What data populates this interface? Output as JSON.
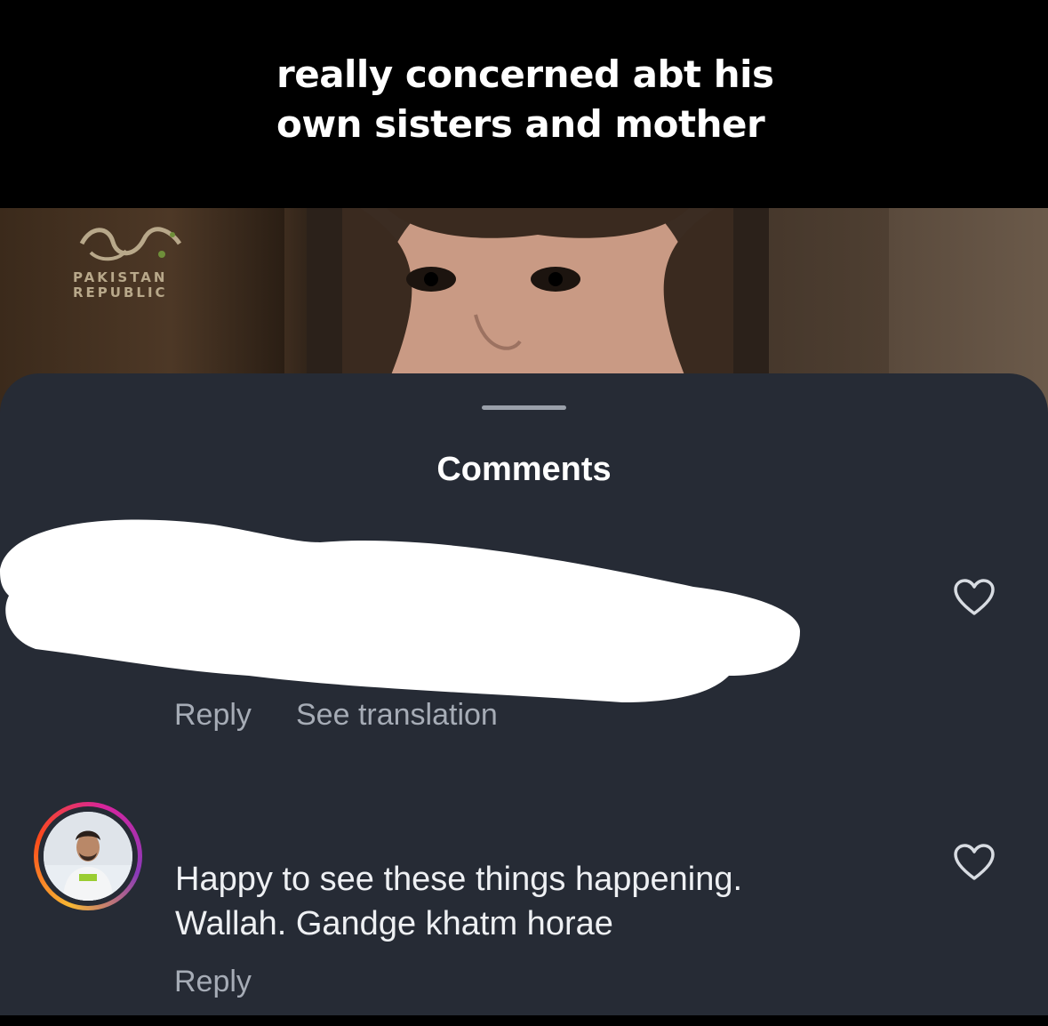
{
  "caption": {
    "line1": "really concerned abt his",
    "line2": "own sisters and mother"
  },
  "photo": {
    "logo_line1": "PAKISTAN",
    "logo_line2": "REPUBLIC"
  },
  "sheet": {
    "title": "Comments"
  },
  "comments": [
    {
      "text": "",
      "redacted": true,
      "actions": [
        "Reply",
        "See translation"
      ],
      "like_icon": "heart-outline-icon"
    },
    {
      "text_line1": "Happy to see these things happening.",
      "text_line2": "Wallah. Gandge khatm horae",
      "actions": [
        "Reply"
      ],
      "avatar": "avatar-story-ring",
      "like_icon": "heart-outline-icon"
    }
  ],
  "colors": {
    "sheet_bg": "#262b35",
    "action_text": "#a6acb6",
    "story_ring": [
      "#f7b733",
      "#fc4a1a",
      "#d6249f",
      "#8a3ab9"
    ]
  }
}
